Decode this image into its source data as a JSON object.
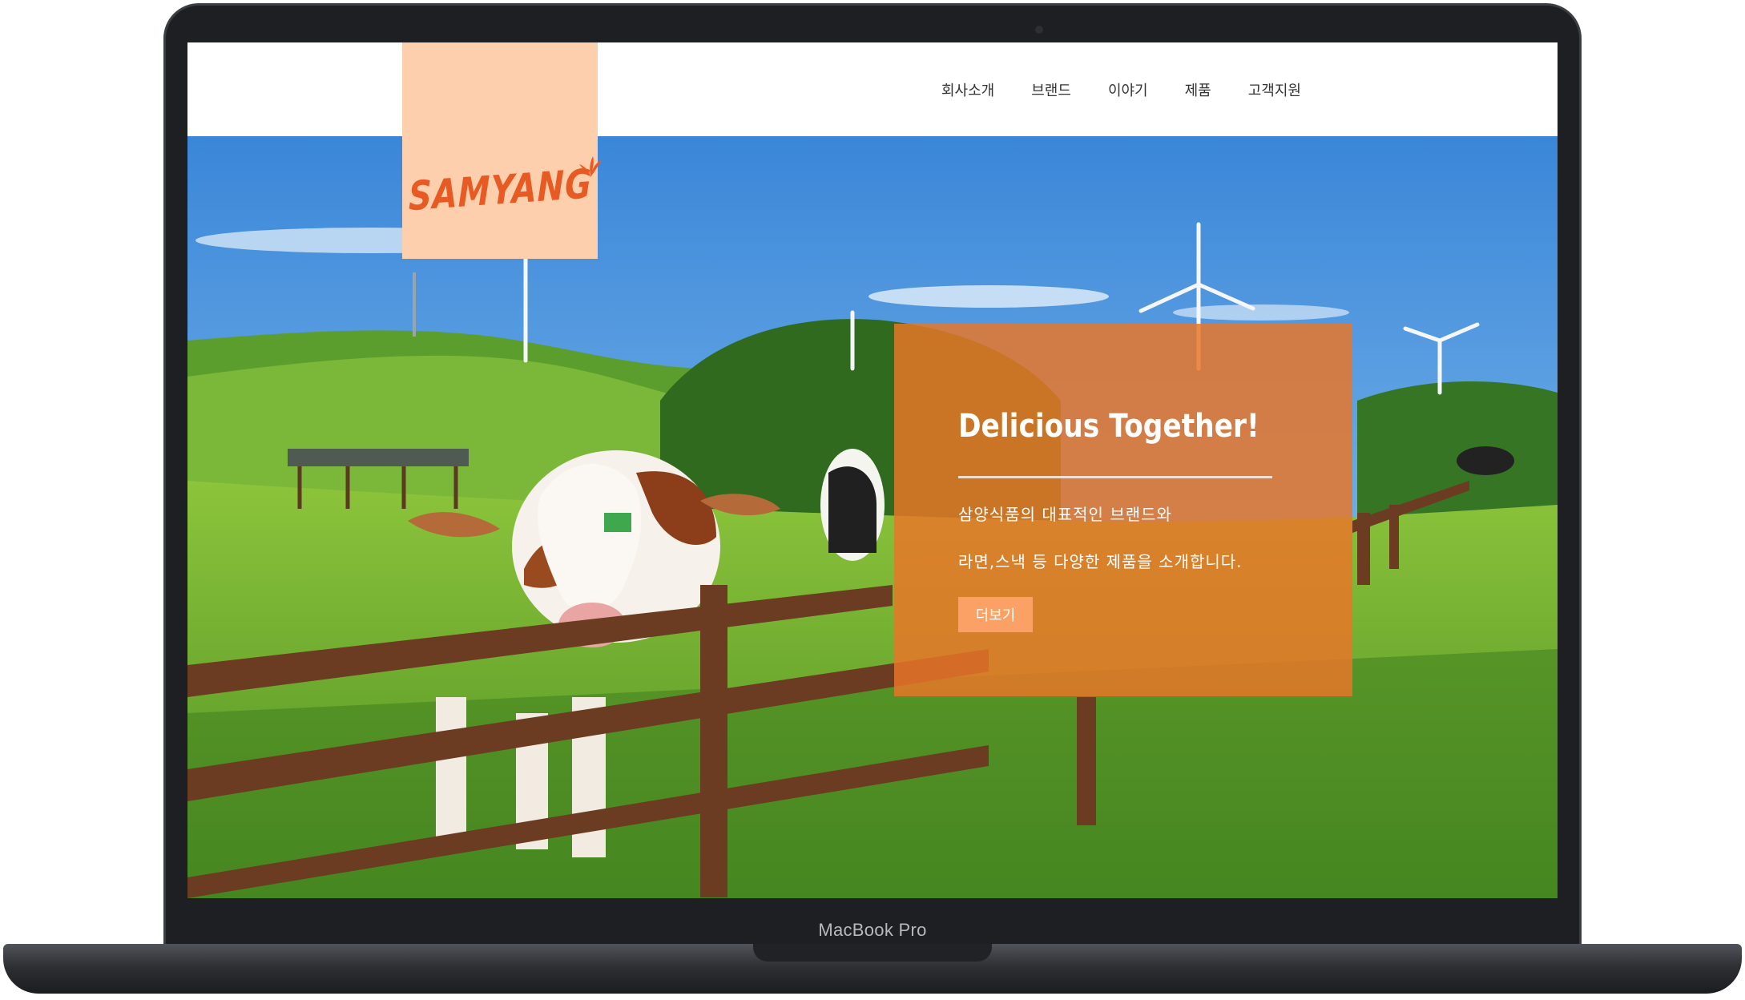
{
  "device": {
    "model_label": "MacBook Pro"
  },
  "site": {
    "logo_text": "SAMYANG",
    "nav": [
      {
        "label": "회사소개"
      },
      {
        "label": "브랜드"
      },
      {
        "label": "이야기"
      },
      {
        "label": "제품"
      },
      {
        "label": "고객지원"
      }
    ],
    "hero": {
      "title": "Delicious Together!",
      "lines": [
        "삼양식품의 대표적인 브랜드와",
        "라면,스낵 등 다양한 제품을 소개합니다."
      ],
      "button_label": "더보기"
    }
  },
  "colors": {
    "logo_bg": "#fdcfac",
    "brand_orange": "#e85a23",
    "card_orange": "#e87628",
    "button_orange": "#fba165"
  },
  "icons": {
    "logo_leaf": "leaf-sprout-icon"
  }
}
